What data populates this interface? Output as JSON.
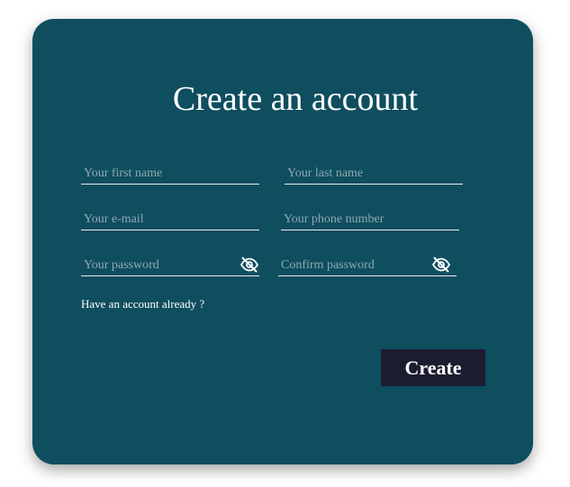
{
  "form": {
    "title": "Create an account",
    "fields": {
      "first_name": {
        "placeholder": "Your first name",
        "value": ""
      },
      "last_name": {
        "placeholder": "Your last name",
        "value": ""
      },
      "email": {
        "placeholder": "Your e-mail",
        "value": ""
      },
      "phone": {
        "placeholder": "Your phone number",
        "value": ""
      },
      "password": {
        "placeholder": "Your password",
        "value": ""
      },
      "confirm_password": {
        "placeholder": "Confirm password",
        "value": ""
      }
    },
    "icons": {
      "password_toggle": "eye-slash-icon",
      "confirm_password_toggle": "eye-slash-icon"
    },
    "have_account_link": "Have an account already ?",
    "create_button": "Create"
  },
  "colors": {
    "card_background": "#0f4e5f",
    "button_background": "#1c1c30",
    "text": "#ffffff",
    "placeholder": "#8fa9b1"
  }
}
